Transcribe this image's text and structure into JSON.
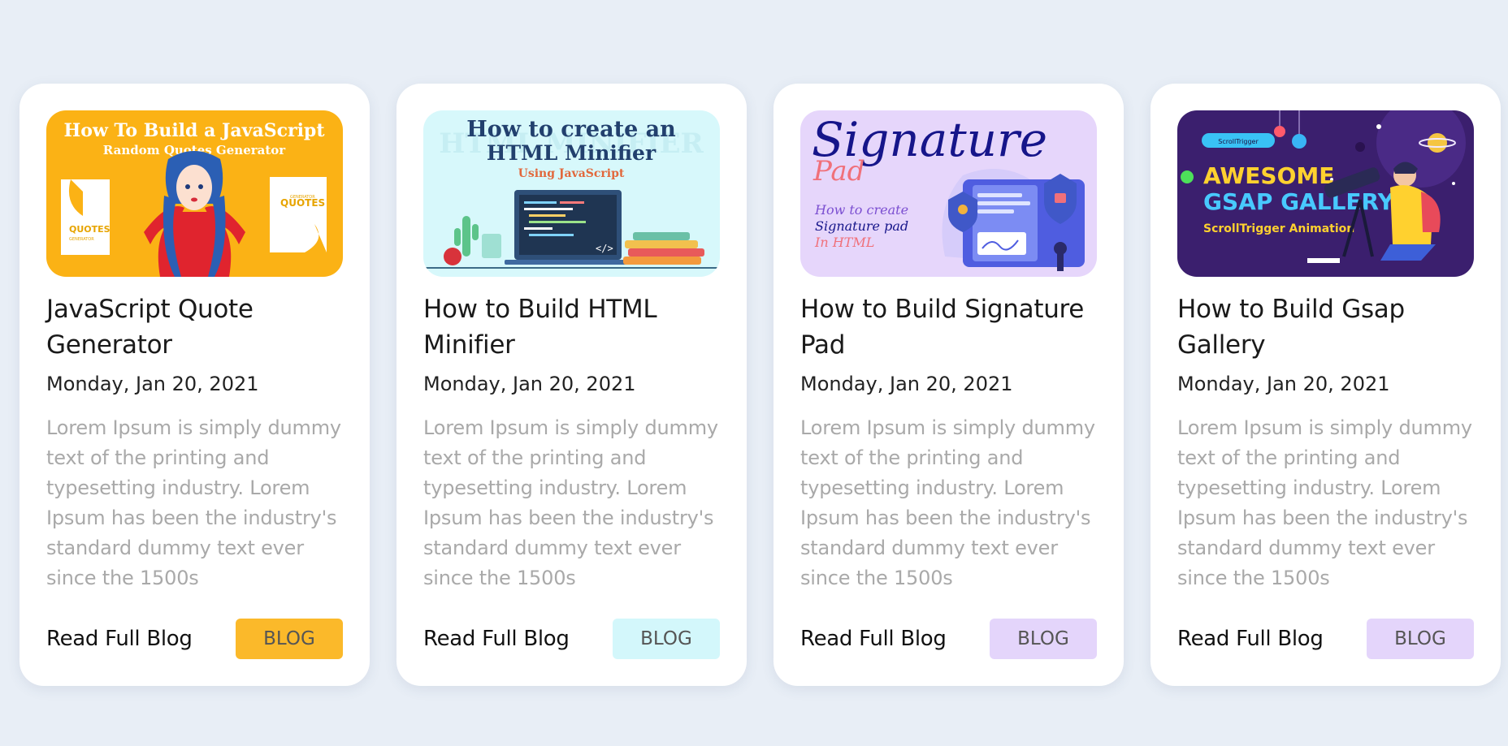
{
  "cards": [
    {
      "image_text": {
        "line1": "How To Build a JavaScript",
        "line2": "Random Quotes Generator",
        "left_tag": "QUOTES",
        "left_sub": "GENERATOR",
        "right_tag": "QUOTES",
        "right_sub": "GENERATOR",
        "image_name": "quote-generator-thumbnail"
      },
      "title": "JavaScript Quote Generator",
      "date": "Monday, Jan 20, 2021",
      "description": "Lorem Ipsum is simply dummy text of the printing and typesetting industry. Lorem Ipsum has been the industry's standard dummy text ever since the 1500s",
      "link_label": "Read Full Blog",
      "badge_label": "BLOG",
      "badge_color": "#fbb92a"
    },
    {
      "image_text": {
        "line1": "How to create an",
        "line2": "HTML Minifier",
        "line3": "Using JavaScript",
        "bg_word": "HTML MINIFIER",
        "code_tag": "</>",
        "image_name": "html-minifier-thumbnail"
      },
      "title": "How to Build HTML Minifier",
      "date": "Monday, Jan 20, 2021",
      "description": "Lorem Ipsum is simply dummy text of the printing and typesetting industry. Lorem Ipsum has been the industry's standard dummy text ever since the 1500s",
      "link_label": "Read Full Blog",
      "badge_label": "BLOG",
      "badge_color": "#d3f7fb"
    },
    {
      "image_text": {
        "line1": "Signature",
        "line2": "Pad",
        "line3": "How to create",
        "line4": "Signature pad",
        "line5": "In HTML",
        "image_name": "signature-pad-thumbnail"
      },
      "title": "How to Build Signature Pad",
      "date": "Monday, Jan 20, 2021",
      "description": "Lorem Ipsum is simply dummy text of the printing and typesetting industry. Lorem Ipsum has been the industry's standard dummy text ever since the 1500s",
      "link_label": "Read Full Blog",
      "badge_label": "BLOG",
      "badge_color": "#e4d5fb"
    },
    {
      "image_text": {
        "pill": "ScrollTrigger",
        "line1": "AWESOME",
        "line2": "GSAP GALLERY",
        "line3": "ScrollTrigger Animation",
        "image_name": "gsap-gallery-thumbnail"
      },
      "title": "How to Build Gsap Gallery",
      "date": "Monday, Jan 20, 2021",
      "description": "Lorem Ipsum is simply dummy text of the printing and typesetting industry. Lorem Ipsum has been the industry's standard dummy text ever since the 1500s",
      "link_label": "Read Full Blog",
      "badge_label": "BLOG",
      "badge_color": "#e4d5fb"
    }
  ]
}
